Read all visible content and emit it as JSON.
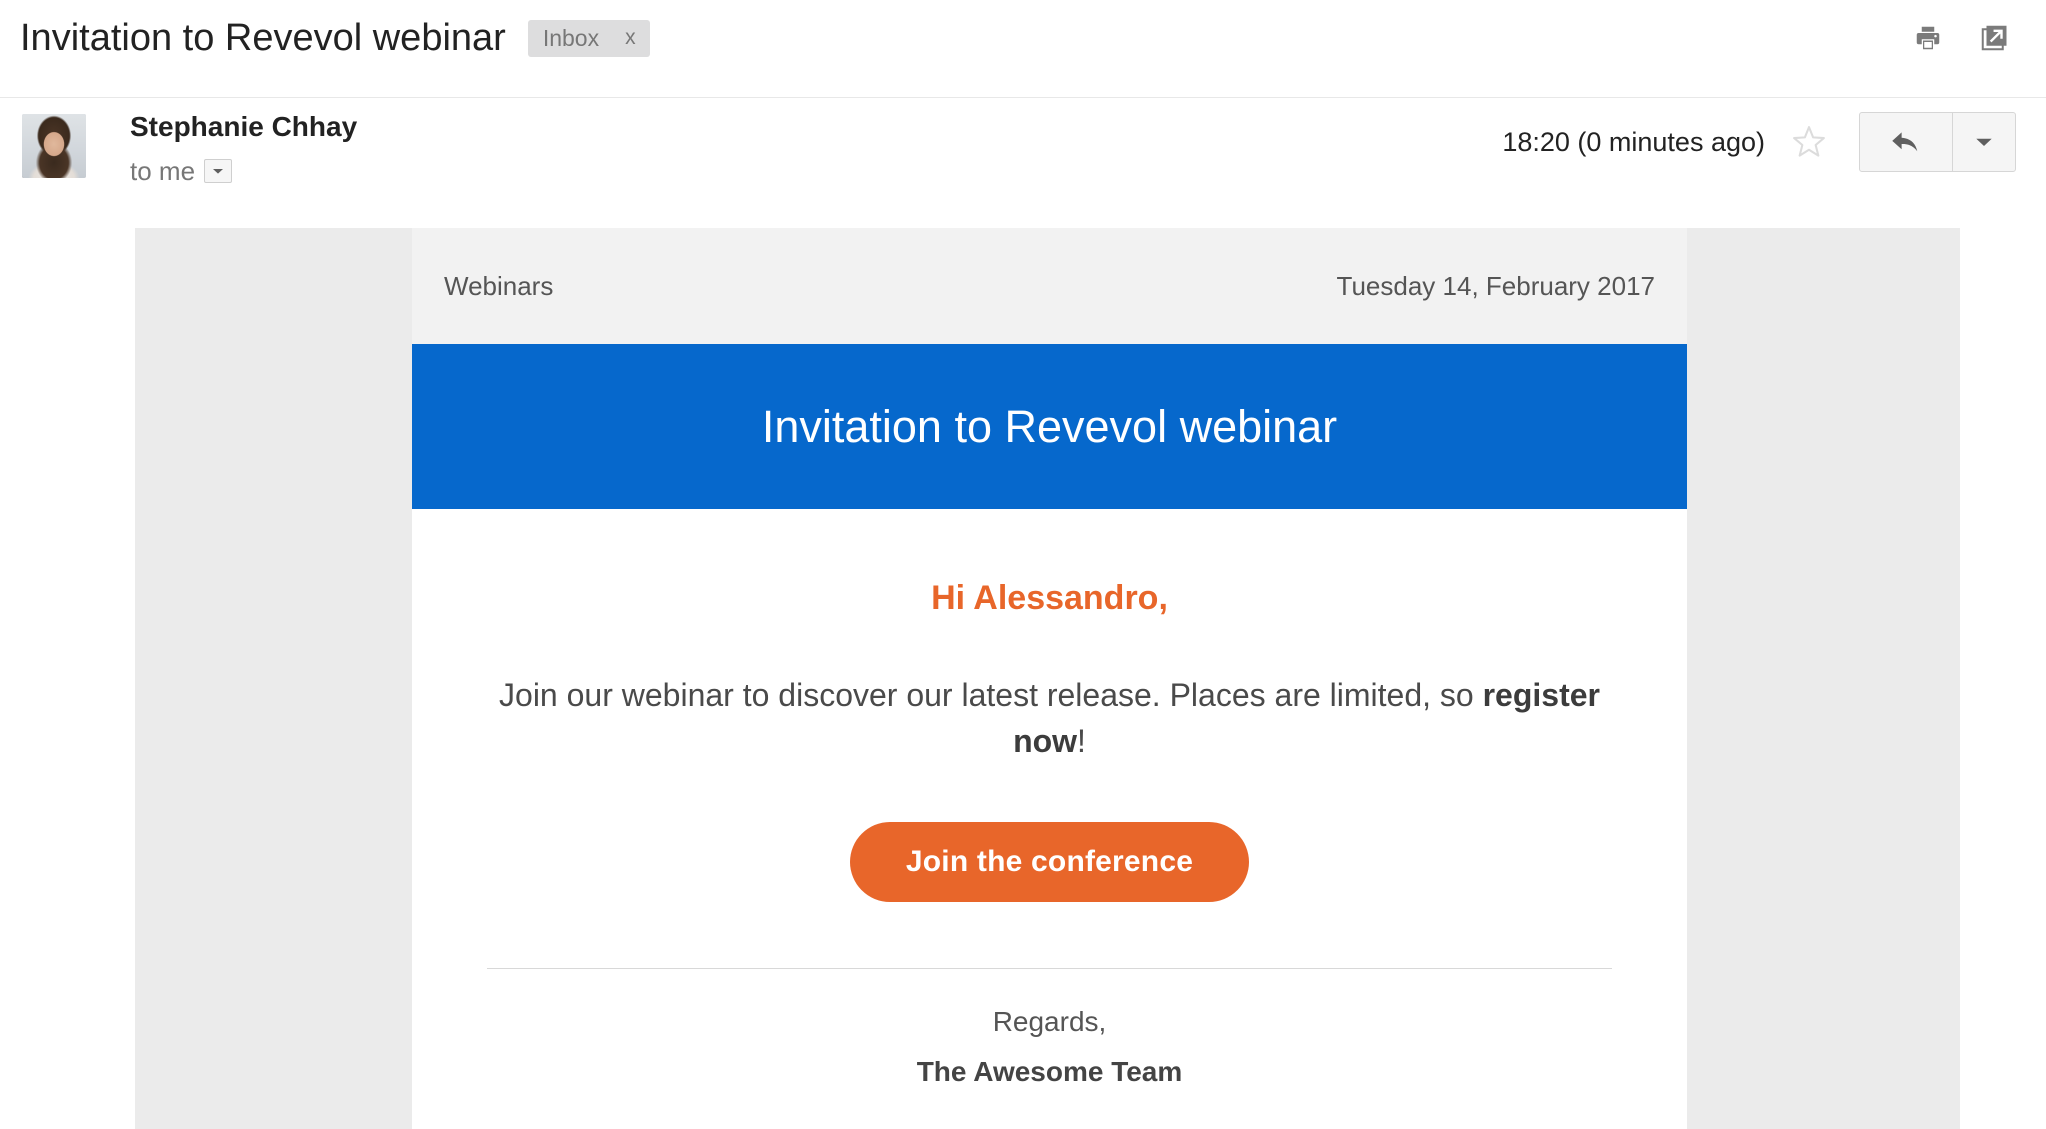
{
  "thread": {
    "subject": "Invitation to Revevol webinar",
    "label": {
      "name": "Inbox",
      "remove": "x"
    },
    "actions": {
      "print_title": "print-icon",
      "popout_title": "open-in-new-window-icon"
    }
  },
  "message": {
    "sender_name": "Stephanie Chhay",
    "recipient": "to me",
    "recipient_caret": "details-caret-icon",
    "timestamp": "18:20 (0 minutes ago)",
    "star": "star-outline-icon",
    "reply": "reply-arrow-icon",
    "reply_more": "more-options-caret-icon"
  },
  "email": {
    "preheader_left": "Webinars",
    "preheader_right": "Tuesday 14, February 2017",
    "banner_title": "Invitation to Revevol webinar",
    "greeting": "Hi Alessandro,",
    "body_text_before": "Join our webinar to discover our latest release. Places are limited, so ",
    "body_text_bold": "register now",
    "body_text_after": "!",
    "cta_label": "Join the conference",
    "signoff": "Regards,",
    "signature": "The Awesome Team"
  },
  "colors": {
    "banner_blue": "#0668cc",
    "accent_orange": "#e8662a",
    "outer_gray": "#ebebeb",
    "preheader_gray": "#f2f2f2",
    "chip_gray": "#ddddde"
  }
}
